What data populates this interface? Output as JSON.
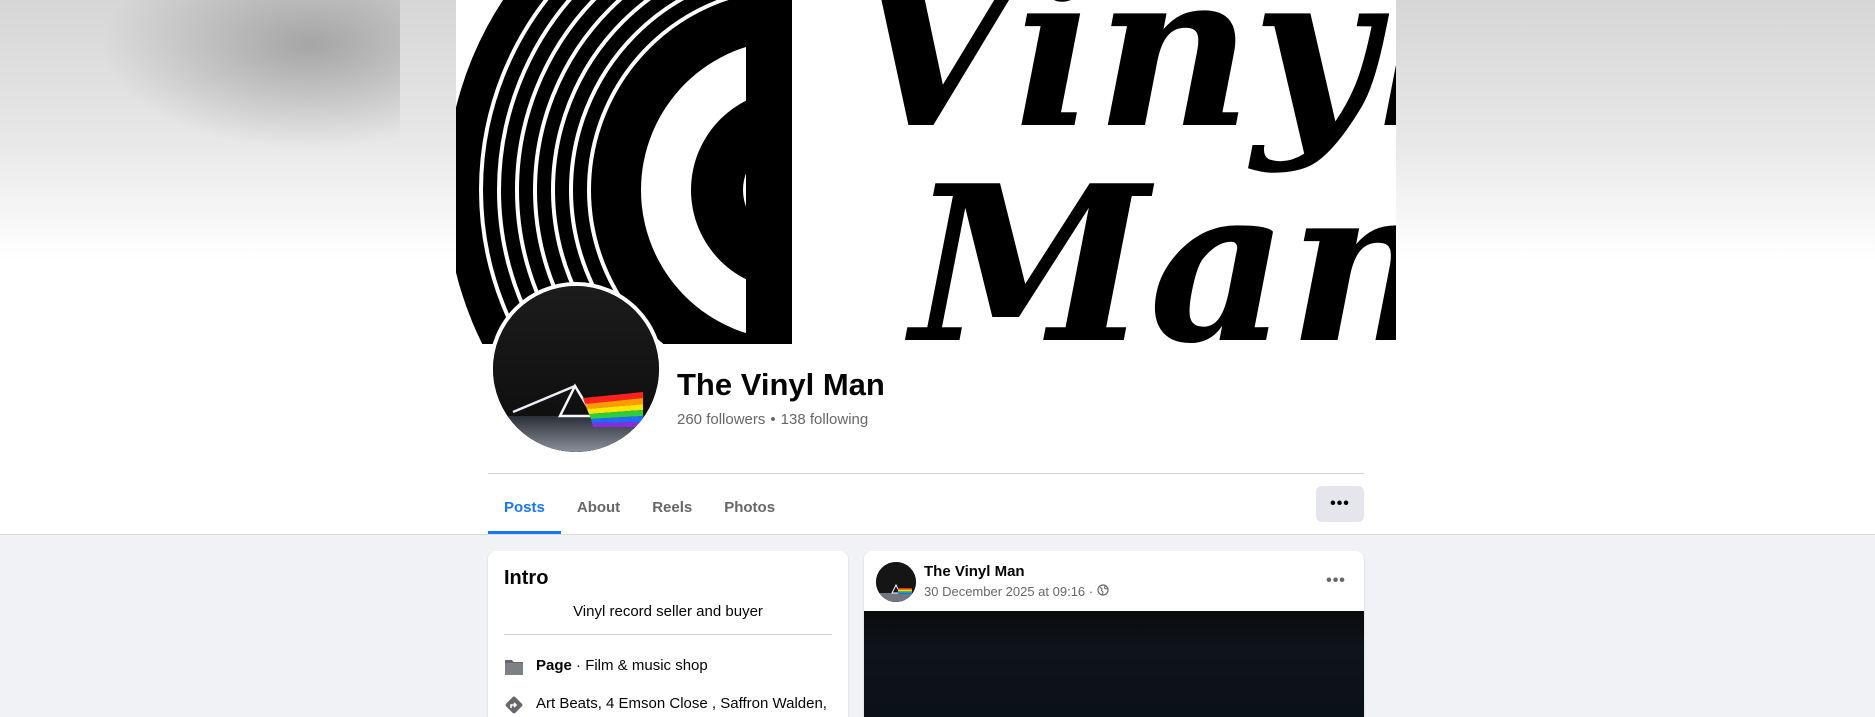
{
  "profile": {
    "name": "The Vinyl Man",
    "followers": "260 followers",
    "separator": "•",
    "following": "138 following"
  },
  "cover": {
    "word_top": "Vinyl",
    "word_bottom": "Man"
  },
  "tabs": [
    {
      "label": "Posts",
      "active": true
    },
    {
      "label": "About",
      "active": false
    },
    {
      "label": "Reels",
      "active": false
    },
    {
      "label": "Photos",
      "active": false
    }
  ],
  "more_button": {
    "label": "•••",
    "icon": "more-horizontal-icon"
  },
  "intro": {
    "title": "Intro",
    "bio": "Vinyl record seller and buyer",
    "page_label": "Page",
    "page_category": " · Film & music shop",
    "address": "Art Beats, 4 Emson Close , Saffron Walden,"
  },
  "post": {
    "author": "The Vinyl Man",
    "timestamp": "30 December 2025 at 09:16 ·",
    "audience_icon": "globe-icon",
    "menu_label": "•••"
  },
  "colors": {
    "accent": "#1877f2",
    "feed_background": "#f0f2f5",
    "secondary_text": "#65676b",
    "button_background": "#e4e6eb"
  }
}
